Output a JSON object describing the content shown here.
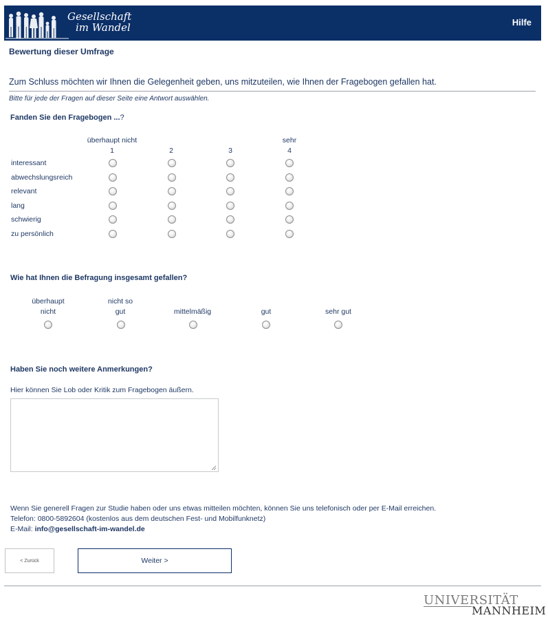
{
  "header": {
    "logo_line1": "Gesellschaft",
    "logo_line2": "im Wandel",
    "help_label": "Hilfe",
    "bg_color": "#0b2f67"
  },
  "page": {
    "section_title": "Bewertung dieser Umfrage",
    "intro": "Zum Schluss möchten wir Ihnen die Gelegenheit geben, uns mitzuteilen, wie Ihnen der Fragebogen gefallen hat.",
    "hint": "Bitte für jede der Fragen auf dieser Seite eine Antwort auswählen."
  },
  "q1": {
    "title": "Fanden Sie den Fragebogen ...",
    "title_tail": "?",
    "scale_low": "überhaupt nicht",
    "scale_high": "sehr",
    "columns": [
      "1",
      "2",
      "3",
      "4"
    ],
    "rows": [
      "interessant",
      "abwechslungsreich",
      "relevant",
      "lang",
      "schwierig",
      "zu persönlich"
    ]
  },
  "q2": {
    "title": "Wie hat Ihnen die Befragung insgesamt gefallen?",
    "options": [
      {
        "line1": "überhaupt",
        "line2": "nicht"
      },
      {
        "line1": "nicht so",
        "line2": "gut"
      },
      {
        "line1": "",
        "line2": "mittelmäßig"
      },
      {
        "line1": "",
        "line2": "gut"
      },
      {
        "line1": "",
        "line2": "sehr gut"
      }
    ]
  },
  "q3": {
    "title": "Haben Sie noch weitere Anmerkungen?",
    "prompt": "Hier können Sie Lob oder Kritik zum Fragebogen äußern.",
    "value": ""
  },
  "contact": {
    "line1": "Wenn Sie generell Fragen zur Studie haben oder uns etwas mitteilen möchten, können Sie uns telefonisch oder per E-Mail erreichen.",
    "line2": "Telefon: 0800-5892604 (kostenlos aus dem deutschen Fest- und Mobilfunknetz)",
    "email_label": "E-Mail: ",
    "email": "info@gesellschaft-im-wandel.de"
  },
  "nav": {
    "back_label": "< Zurück",
    "next_label": "Weiter >"
  },
  "footer": {
    "uni_line1": "UNIVERSITÄT",
    "uni_line2": "MANNHEIM"
  }
}
